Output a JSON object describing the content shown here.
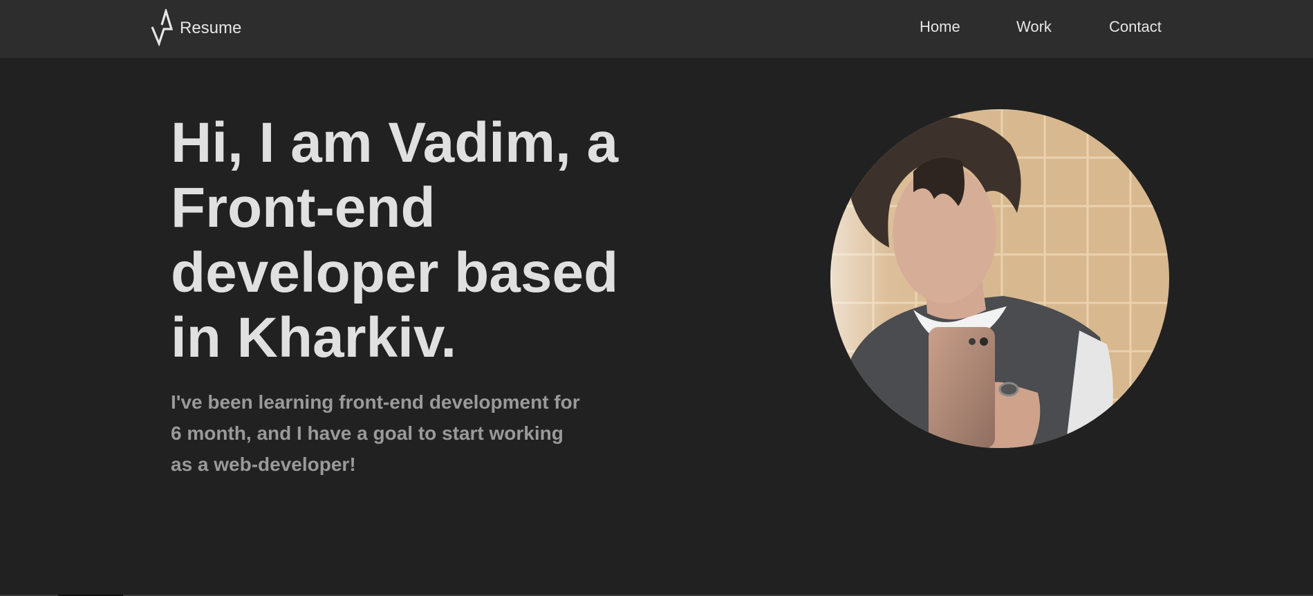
{
  "header": {
    "logo_text": "Resume",
    "nav": {
      "home": "Home",
      "work": "Work",
      "contact": "Contact"
    }
  },
  "hero": {
    "title_lines": [
      "Hi, I am Vadim, a",
      "Front-end",
      "developer based",
      "in Kharkiv."
    ],
    "text_lines": [
      "I've been learning front-end development for",
      "6 month, and I have a goal to start working",
      "as a web-developer!"
    ]
  },
  "colors": {
    "background": "#212121",
    "header_bg": "#2d2d2d",
    "heading": "#e0e0e0",
    "body_text": "#9a9a9a",
    "nav_text": "#e6e6e6"
  }
}
